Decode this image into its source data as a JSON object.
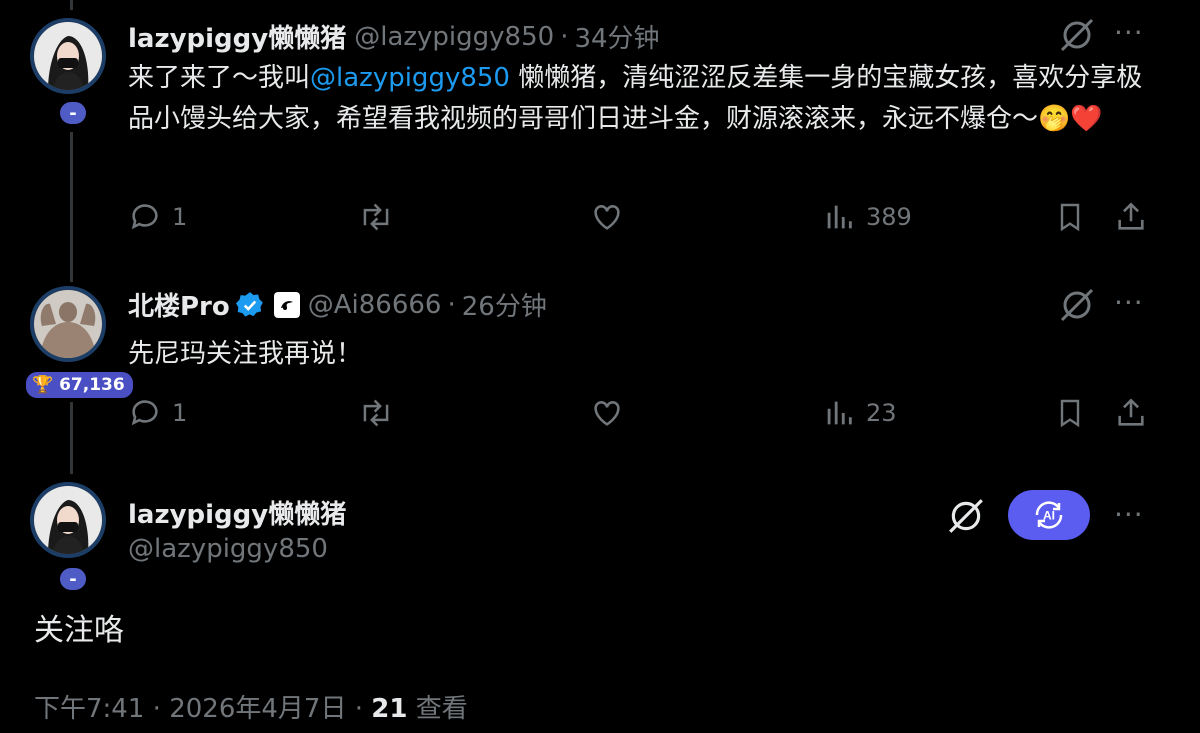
{
  "tweets": [
    {
      "name": "lazypiggy懒懒猪",
      "handle": "@lazypiggy850",
      "dot": "·",
      "time": "34分钟",
      "text_before": "来了来了～我叫",
      "mention": "@lazypiggy850",
      "text_after": " 懒懒猪，清纯涩涩反差集一身的宝藏女孩，喜欢分享极品小馒头给大家，希望看我视频的哥哥们日进斗金，财源滚滚来，永远不爆仓～",
      "emoji": "🤭❤️",
      "badge": "-",
      "replies": "1",
      "views": "389"
    },
    {
      "name": "北楼Pro",
      "handle": "@Ai86666",
      "dot": "·",
      "time": "26分钟",
      "text": "先尼玛关注我再说！",
      "badge": "🏆 67,136",
      "replies": "1",
      "views": "23"
    },
    {
      "name": "lazypiggy懒懒猪",
      "handle": "@lazypiggy850",
      "text": "关注咯",
      "badge": "-"
    }
  ],
  "footer": {
    "time": "下午7:41",
    "dot1": "·",
    "date": "2026年4月7日",
    "dot2": "·",
    "views_count": "21",
    "views_label": "查看"
  },
  "icons": {
    "more": "···",
    "ai_label": "AI"
  },
  "colors": {
    "background": "#000000",
    "mention": "#1d9bf0",
    "muted": "#71767b",
    "ai_button": "#5a5df0",
    "badge": "#4f5cc6"
  }
}
